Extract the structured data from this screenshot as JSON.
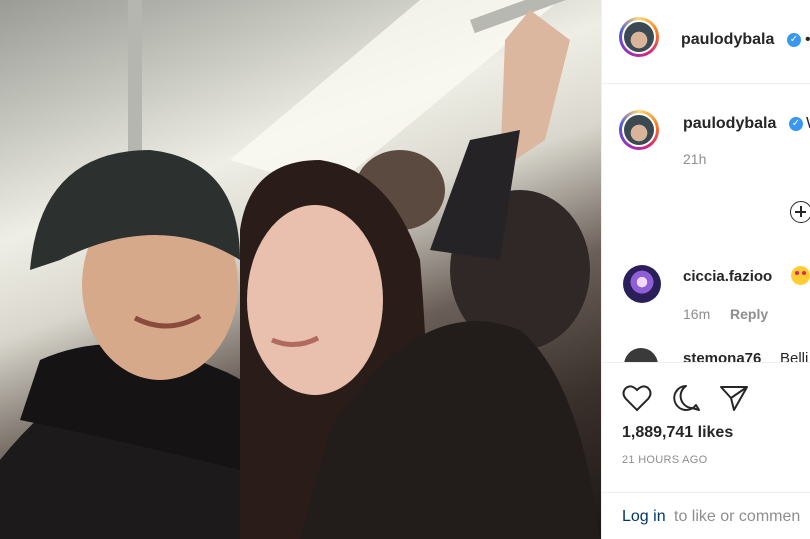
{
  "header": {
    "username": "paulodybala",
    "menu_glyph": "•"
  },
  "caption": {
    "username": "paulodybala",
    "text_start": "W",
    "time": "21h"
  },
  "comments": [
    {
      "username": "ciccia.fazioo",
      "emoji": "heart-eyes-emoji",
      "time": "16m",
      "reply_label": "Reply"
    },
    {
      "username": "stemona76",
      "text": "Belli"
    }
  ],
  "post": {
    "likes": "1,889,741 likes",
    "posted": "21 HOURS AGO"
  },
  "footer": {
    "login_label": "Log in",
    "login_rest": "to like or commen"
  },
  "colors": {
    "verified": "#3897f0",
    "link": "#003569",
    "muted": "#8e8e8e"
  }
}
